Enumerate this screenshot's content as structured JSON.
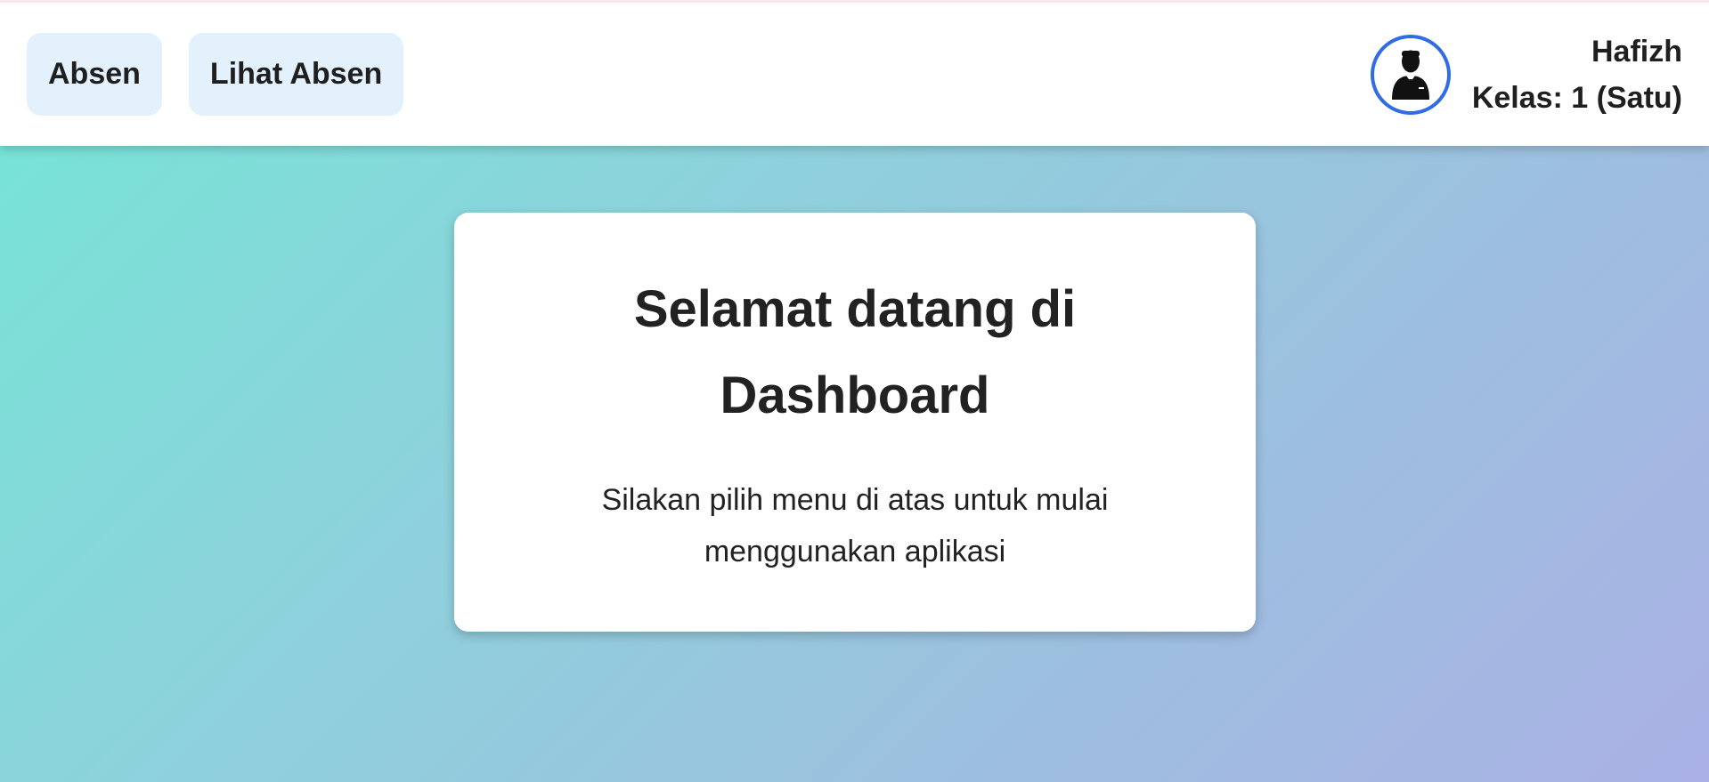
{
  "nav": {
    "items": [
      {
        "label": "Absen"
      },
      {
        "label": "Lihat Absen"
      }
    ]
  },
  "user": {
    "name": "Hafizh",
    "class_label": "Kelas: 1 (Satu)",
    "avatar_icon": "person-suit-icon",
    "avatar_border_color": "#2f6ce5"
  },
  "welcome": {
    "title": "Selamat datang di Dashboard",
    "message": "Silakan pilih menu di atas untuk mulai menggunakan aplikasi"
  }
}
